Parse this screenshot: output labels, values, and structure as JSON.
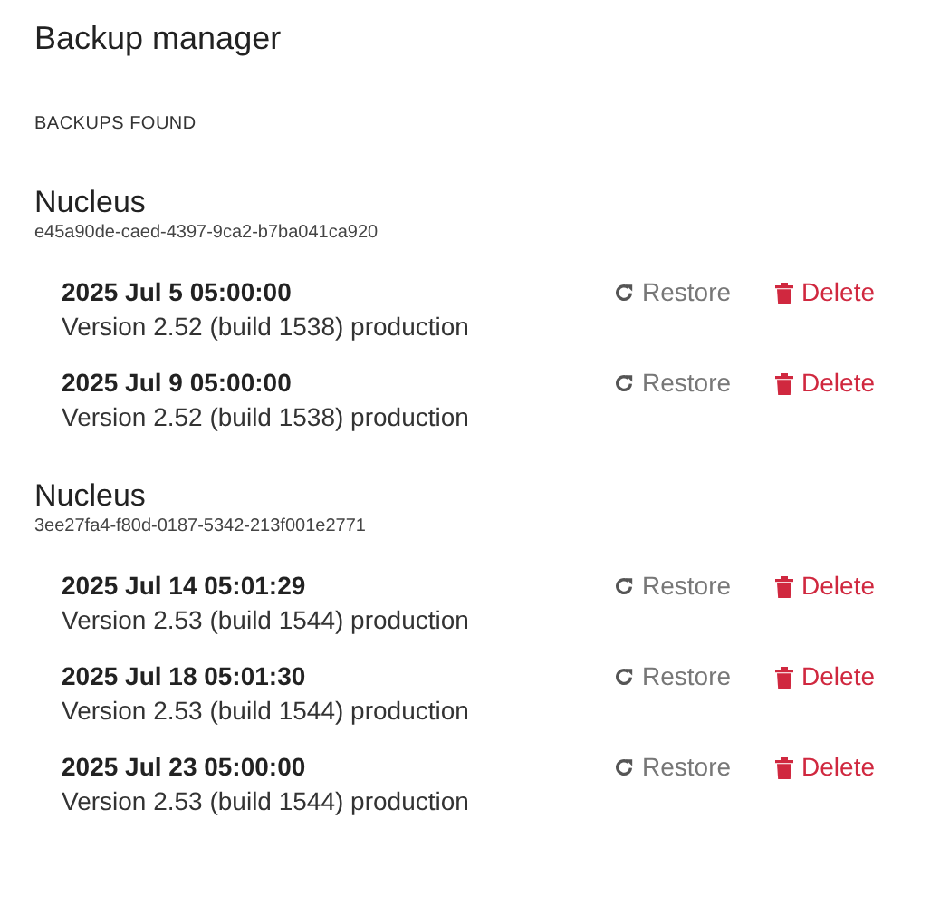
{
  "title": "Backup manager",
  "section_label": "BACKUPS FOUND",
  "groups": [
    {
      "name": "Nucleus",
      "id": "e45a90de-caed-4397-9ca2-b7ba041ca920",
      "backups": [
        {
          "date": "2025 Jul 5 05:00:00",
          "version": "Version 2.52 (build 1538) production",
          "restore": "Restore",
          "delete": "Delete"
        },
        {
          "date": "2025 Jul 9 05:00:00",
          "version": "Version 2.52 (build 1538) production",
          "restore": "Restore",
          "delete": "Delete"
        }
      ]
    },
    {
      "name": "Nucleus",
      "id": "3ee27fa4-f80d-0187-5342-213f001e2771",
      "backups": [
        {
          "date": "2025 Jul 14 05:01:29",
          "version": "Version 2.53 (build 1544) production",
          "restore": "Restore",
          "delete": "Delete"
        },
        {
          "date": "2025 Jul 18 05:01:30",
          "version": "Version 2.53 (build 1544) production",
          "restore": "Restore",
          "delete": "Delete"
        },
        {
          "date": "2025 Jul 23 05:00:00",
          "version": "Version 2.53 (build 1544) production",
          "restore": "Restore",
          "delete": "Delete"
        }
      ]
    }
  ]
}
